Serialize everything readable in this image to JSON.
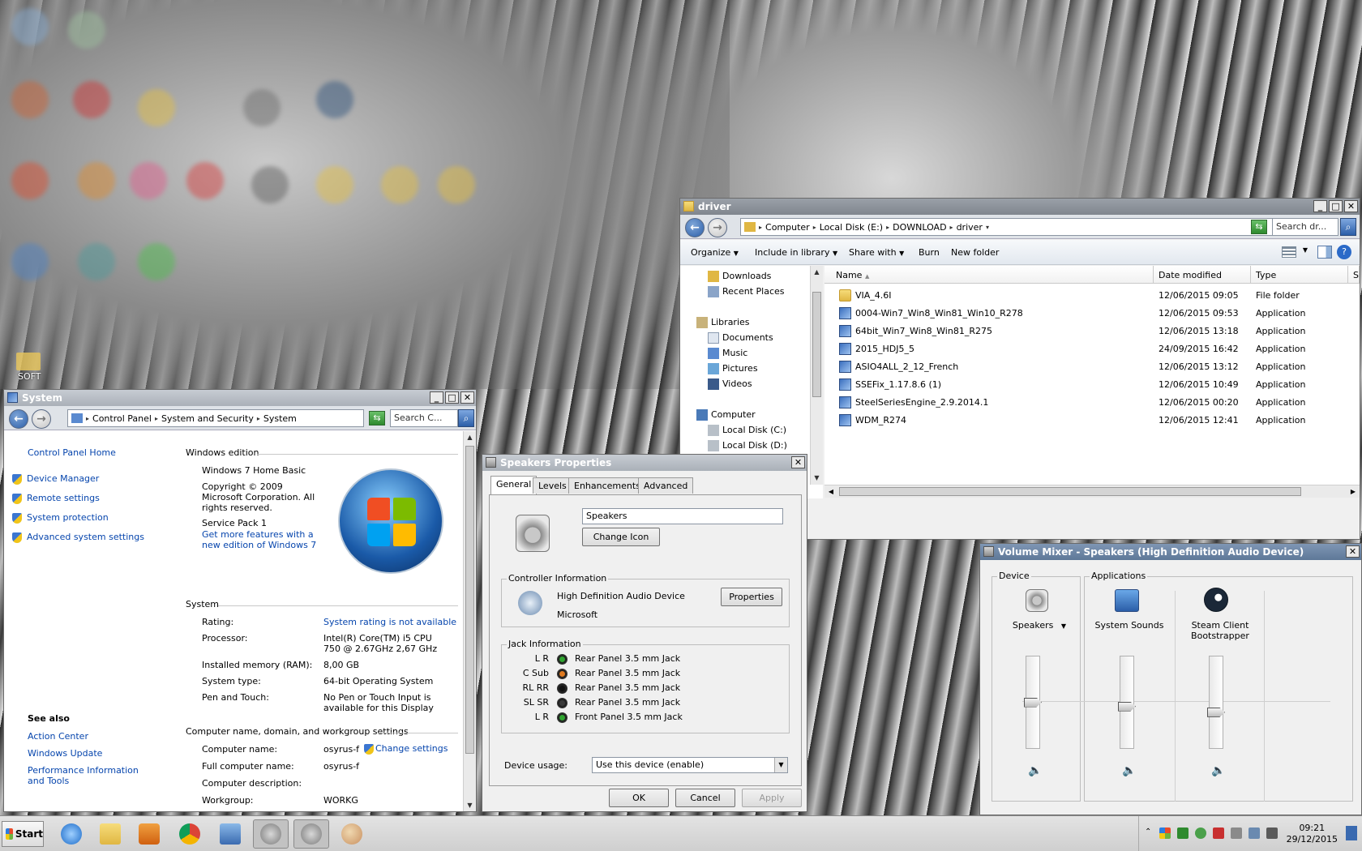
{
  "desktop": {
    "icon_label": "SOFT"
  },
  "system_window": {
    "title": "System",
    "breadcrumb": [
      "Control Panel",
      "System and Security",
      "System"
    ],
    "search_placeholder": "Search C...",
    "sidebar": {
      "home": "Control Panel Home",
      "links": [
        "Device Manager",
        "Remote settings",
        "System protection",
        "Advanced system settings"
      ],
      "see_also_title": "See also",
      "see_also": [
        "Action Center",
        "Windows Update",
        "Performance Information and Tools"
      ]
    },
    "edition": {
      "header": "Windows edition",
      "name": "Windows 7 Home Basic",
      "copyright": "Copyright © 2009 Microsoft Corporation.  All rights reserved.",
      "service_pack": "Service Pack 1",
      "more_features": "Get more features with a new edition of Windows 7"
    },
    "system": {
      "header": "System",
      "rows": [
        {
          "label": "Rating:",
          "value": "System rating is not available",
          "link": true
        },
        {
          "label": "Processor:",
          "value": "Intel(R) Core(TM) i5 CPU\n750  @ 2.67GHz   2,67 GHz",
          "link": false
        },
        {
          "label": "Installed memory (RAM):",
          "value": "8,00 GB",
          "link": false
        },
        {
          "label": "System type:",
          "value": "64-bit Operating System",
          "link": false
        },
        {
          "label": "Pen and Touch:",
          "value": "No Pen or Touch Input is available for this Display",
          "link": false
        }
      ]
    },
    "computer": {
      "header": "Computer name, domain, and workgroup settings",
      "change_settings": "Change settings",
      "rows": [
        {
          "label": "Computer name:",
          "value": "osyrus-f"
        },
        {
          "label": "Full computer name:",
          "value": "osyrus-f"
        },
        {
          "label": "Computer description:",
          "value": ""
        },
        {
          "label": "Workgroup:",
          "value": "WORKG"
        }
      ]
    }
  },
  "explorer": {
    "title": "driver",
    "breadcrumb": [
      "Computer",
      "Local Disk (E:)",
      "DOWNLOAD",
      "driver"
    ],
    "search_placeholder": "Search dr...",
    "toolbar": [
      "Organize",
      "Include in library",
      "Share with",
      "Burn",
      "New folder"
    ],
    "nav": {
      "favorites": [
        "Downloads",
        "Recent Places"
      ],
      "libraries_title": "Libraries",
      "libraries": [
        "Documents",
        "Music",
        "Pictures",
        "Videos"
      ],
      "computer_title": "Computer",
      "drives": [
        "Local Disk (C:)",
        "Local Disk (D:)"
      ]
    },
    "columns": [
      "Name",
      "Date modified",
      "Type",
      "S"
    ],
    "files": [
      {
        "name": "VIA_4.6I",
        "date": "12/06/2015 09:05",
        "type": "File folder",
        "kind": "folder"
      },
      {
        "name": "0004-Win7_Win8_Win81_Win10_R278",
        "date": "12/06/2015 09:53",
        "type": "Application",
        "kind": "app"
      },
      {
        "name": "64bit_Win7_Win8_Win81_R275",
        "date": "12/06/2015 13:18",
        "type": "Application",
        "kind": "app"
      },
      {
        "name": "2015_HDJ5_5",
        "date": "24/09/2015 16:42",
        "type": "Application",
        "kind": "app"
      },
      {
        "name": "ASIO4ALL_2_12_French",
        "date": "12/06/2015 13:12",
        "type": "Application",
        "kind": "app"
      },
      {
        "name": "SSEFix_1.17.8.6 (1)",
        "date": "12/06/2015 10:49",
        "type": "Application",
        "kind": "app"
      },
      {
        "name": "SteelSeriesEngine_2.9.2014.1",
        "date": "12/06/2015 00:20",
        "type": "Application",
        "kind": "app"
      },
      {
        "name": "WDM_R274",
        "date": "12/06/2015 12:41",
        "type": "Application",
        "kind": "app"
      }
    ]
  },
  "speakers": {
    "title": "Speakers Properties",
    "tabs": [
      "General",
      "Levels",
      "Enhancements",
      "Advanced"
    ],
    "name_value": "Speakers",
    "change_icon": "Change Icon",
    "controller_title": "Controller Information",
    "controller_name": "High Definition Audio Device",
    "controller_vendor": "Microsoft",
    "properties": "Properties",
    "jack_title": "Jack Information",
    "jacks": [
      {
        "label": "L R",
        "desc": "Rear Panel 3.5 mm Jack",
        "color": "#2fa52f"
      },
      {
        "label": "C Sub",
        "desc": "Rear Panel 3.5 mm Jack",
        "color": "#e07a1f"
      },
      {
        "label": "RL RR",
        "desc": "Rear Panel 3.5 mm Jack",
        "color": "#111111"
      },
      {
        "label": "SL SR",
        "desc": "Rear Panel 3.5 mm Jack",
        "color": "#3a3a3a"
      },
      {
        "label": "L R",
        "desc": "Front Panel 3.5 mm Jack",
        "color": "#2fa52f"
      }
    ],
    "device_usage_label": "Device usage:",
    "device_usage_value": "Use this device (enable)",
    "ok": "OK",
    "cancel": "Cancel",
    "apply": "Apply"
  },
  "mixer": {
    "title": "Volume Mixer - Speakers (High Definition Audio Device)",
    "device_label": "Device",
    "applications_label": "Applications",
    "channels": [
      {
        "name": "Speakers",
        "level": 0.5
      },
      {
        "name": "System Sounds",
        "level": 0.45
      },
      {
        "name": "Steam Client\nBootstrapper",
        "level": 0.38
      }
    ]
  },
  "taskbar": {
    "start": "Start",
    "time": "09:21",
    "date": "29/12/2015"
  }
}
